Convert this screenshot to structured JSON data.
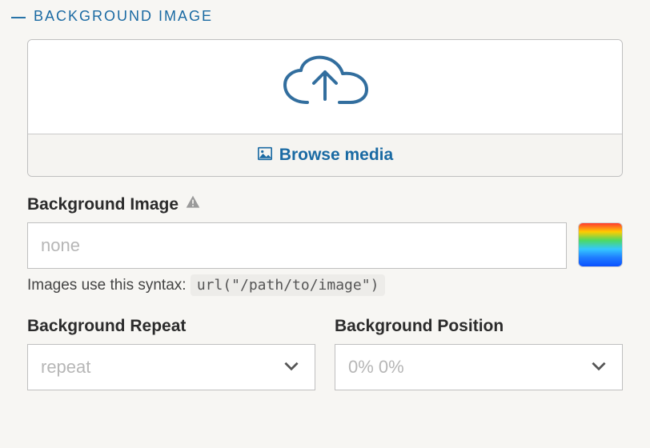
{
  "section": {
    "title": "BACKGROUND IMAGE"
  },
  "upload": {
    "browse_label": "Browse media"
  },
  "bg_image": {
    "label": "Background Image",
    "placeholder": "none",
    "value": "",
    "syntax_prefix": "Images use this syntax: ",
    "syntax_code": "url(\"/path/to/image\")"
  },
  "bg_repeat": {
    "label": "Background Repeat",
    "value": "repeat"
  },
  "bg_position": {
    "label": "Background Position",
    "value": "0% 0%"
  }
}
